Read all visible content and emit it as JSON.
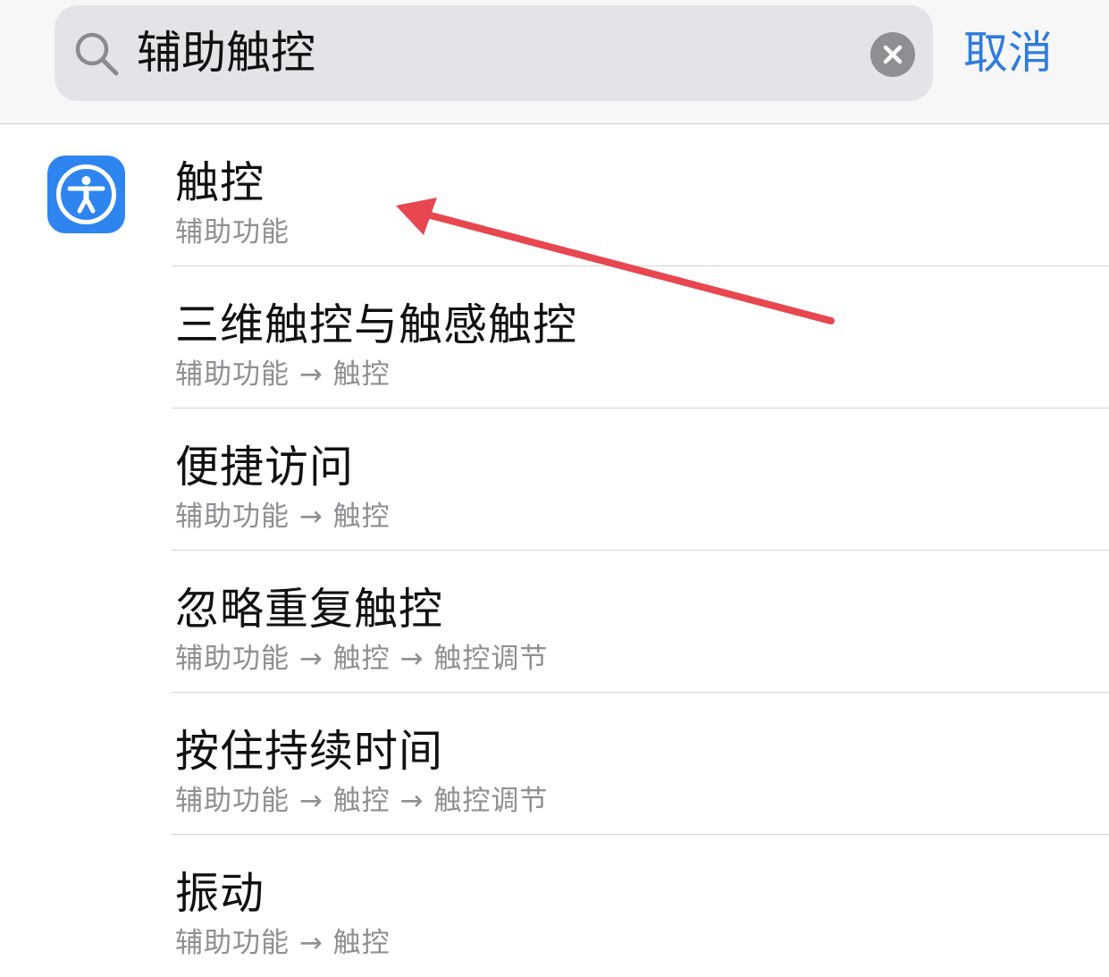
{
  "search": {
    "query": "辅助触控",
    "cancel_label": "取消",
    "icon": "search-icon",
    "clear_icon": "clear-circle-icon"
  },
  "results": [
    {
      "title": "触控",
      "path": "辅助功能",
      "icon": "accessibility-icon"
    },
    {
      "title": "三维触控与触感触控",
      "path": "辅助功能 → 触控"
    },
    {
      "title": "便捷访问",
      "path": "辅助功能 → 触控"
    },
    {
      "title": "忽略重复触控",
      "path": "辅助功能 → 触控 → 触控调节"
    },
    {
      "title": "按住持续时间",
      "path": "辅助功能 → 触控 → 触控调节"
    },
    {
      "title": "振动",
      "path": "辅助功能 → 触控"
    }
  ],
  "colors": {
    "accent": "#2f7cdc",
    "app_icon_bg": "#2e85f0",
    "annotation_arrow": "#e8474f",
    "secondary_text": "#8e8e93"
  }
}
